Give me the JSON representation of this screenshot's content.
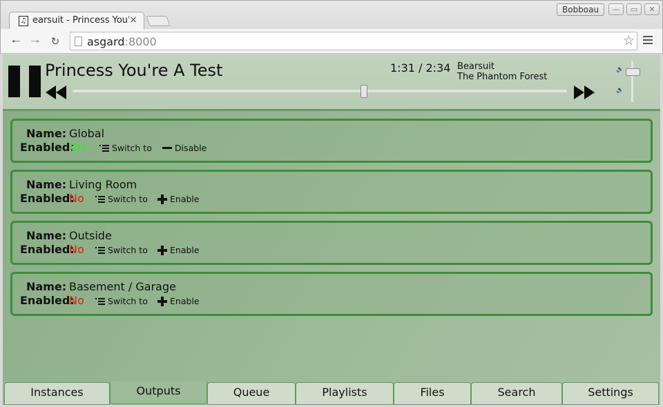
{
  "browser": {
    "tab_title": "earsuit - Princess You're",
    "tab_close": "×",
    "favicon_glyph": "♫",
    "profile_name": "Bobboau",
    "url_host": "asgard",
    "url_port": ":8000",
    "window_buttons": [
      "—",
      "▭",
      "✕"
    ]
  },
  "player": {
    "song_title": "Princess You're A Test",
    "time": "1:31 / 2:34",
    "artist": "Bearsuit",
    "album": "The Phantom Forest",
    "progress_fraction": 0.59,
    "volume_fraction": 0.72
  },
  "outputs": [
    {
      "name_label": "Name:",
      "name": "Global",
      "enabled_label": "Enabled:",
      "enabled": "Yes",
      "enabled_state": "yes",
      "switch_label": "Switch to",
      "toggle_label": "Disable",
      "toggle_icon": "minus-icon"
    },
    {
      "name_label": "Name:",
      "name": "Living Room",
      "enabled_label": "Enabled:",
      "enabled": "No",
      "enabled_state": "no",
      "switch_label": "Switch to",
      "toggle_label": "Enable",
      "toggle_icon": "plus-icon"
    },
    {
      "name_label": "Name:",
      "name": "Outside",
      "enabled_label": "Enabled:",
      "enabled": "No",
      "enabled_state": "no",
      "switch_label": "Switch to",
      "toggle_label": "Enable",
      "toggle_icon": "plus-icon"
    },
    {
      "name_label": "Name:",
      "name": "Basement / Garage",
      "enabled_label": "Enabled:",
      "enabled": "No",
      "enabled_state": "no",
      "switch_label": "Switch to",
      "toggle_label": "Enable",
      "toggle_icon": "plus-icon"
    }
  ],
  "tabs": [
    {
      "label": "Instances",
      "active": false
    },
    {
      "label": "Outputs",
      "active": true
    },
    {
      "label": "Queue",
      "active": false
    },
    {
      "label": "Playlists",
      "active": false
    },
    {
      "label": "Files",
      "active": false
    },
    {
      "label": "Search",
      "active": false
    },
    {
      "label": "Settings",
      "active": false
    }
  ],
  "colors": {
    "accent_green": "#3e8c3a",
    "enabled_yes": "#35e635",
    "enabled_no": "#dd1d12"
  }
}
